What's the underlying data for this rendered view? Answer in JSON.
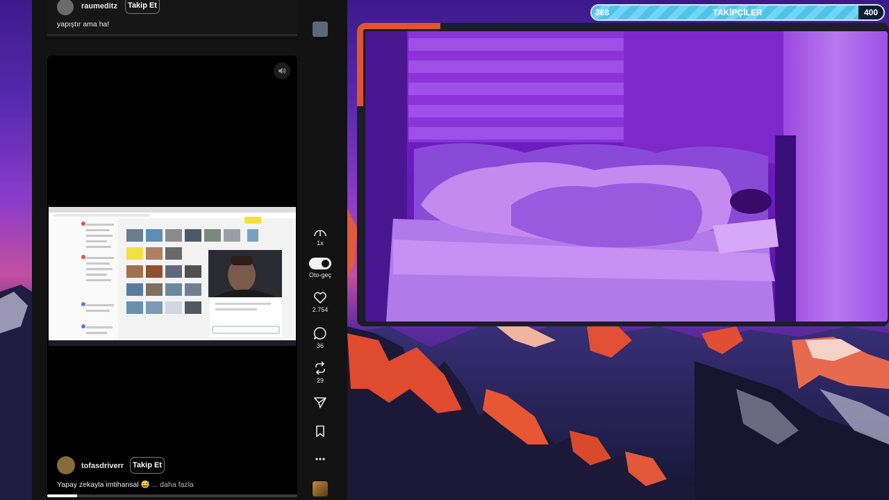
{
  "feed": {
    "previous_post": {
      "username": "raumeditz",
      "follow_label": "Takip Et",
      "caption": "yapıştır ama ha!"
    },
    "current_post": {
      "username": "tofasdriverr",
      "follow_label": "Takip Et",
      "caption": "Yapay zekayla imtihansal",
      "caption_emoji": "😅",
      "more_label": "... daha fazla",
      "progress": 0.12
    },
    "actions": {
      "speed_label": "1x",
      "autoplay_label": "Oto-geç",
      "likes": "2.754",
      "comments": "36",
      "reposts": "29"
    }
  },
  "goal_bar": {
    "current": "368",
    "label": "TAKİPÇİLER",
    "target": "400",
    "fraction": 0.92
  },
  "colors": {
    "accent": "#e0542e",
    "goal_fill": "#4fc3e8",
    "panel": "#121212"
  }
}
